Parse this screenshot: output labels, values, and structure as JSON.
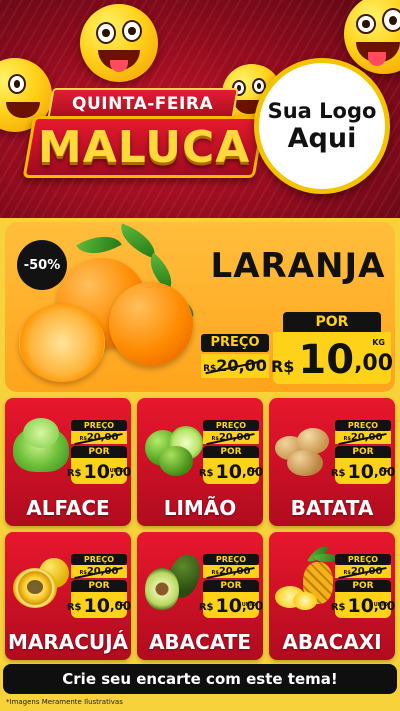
{
  "header": {
    "badge_top": "QUINTA-FEIRA",
    "badge_main": "MALUCA",
    "logo_line1": "Sua Logo",
    "logo_line2": "Aqui"
  },
  "featured": {
    "discount": "-50%",
    "name": "LARANJA",
    "preco_label": "PREÇO",
    "old_currency": "R$",
    "old_price": "20,00",
    "por_label": "POR",
    "currency": "R$",
    "price_int": "10",
    "price_dec": ",00",
    "unit": "KG"
  },
  "products": [
    {
      "name": "ALFACE",
      "preco_label": "PREÇO",
      "old_currency": "R$",
      "old_price": "20,00",
      "por_label": "POR",
      "currency": "R$",
      "price_int": "10",
      "price_dec": ",00",
      "unit": "UNID"
    },
    {
      "name": "LIMÃO",
      "preco_label": "PREÇO",
      "old_currency": "R$",
      "old_price": "20,00",
      "por_label": "POR",
      "currency": "R$",
      "price_int": "10",
      "price_dec": ",00",
      "unit": "KG"
    },
    {
      "name": "BATATA",
      "preco_label": "PREÇO",
      "old_currency": "R$",
      "old_price": "20,00",
      "por_label": "POR",
      "currency": "R$",
      "price_int": "10",
      "price_dec": ",00",
      "unit": "KG"
    },
    {
      "name": "MARACUJÁ",
      "preco_label": "PREÇO",
      "old_currency": "R$",
      "old_price": "20,00",
      "por_label": "POR",
      "currency": "R$",
      "price_int": "10",
      "price_dec": ",00",
      "unit": "KG"
    },
    {
      "name": "ABACATE",
      "preco_label": "PREÇO",
      "old_currency": "R$",
      "old_price": "20,00",
      "por_label": "POR",
      "currency": "R$",
      "price_int": "10",
      "price_dec": ",00",
      "unit": "UNID"
    },
    {
      "name": "ABACAXI",
      "preco_label": "PREÇO",
      "old_currency": "R$",
      "old_price": "20,00",
      "por_label": "POR",
      "currency": "R$",
      "price_int": "10",
      "price_dec": ",00",
      "unit": "UNID"
    }
  ],
  "footer": {
    "cta": "Crie seu encarte com este tema!",
    "disclaimer": "*Imagens Meramente Ilustrativas"
  },
  "colors": {
    "header_red": "#8d0b1d",
    "card_red": "#e8172d",
    "yellow": "#ffd21a",
    "black": "#121212",
    "orange_panel": "#ffa41c"
  }
}
